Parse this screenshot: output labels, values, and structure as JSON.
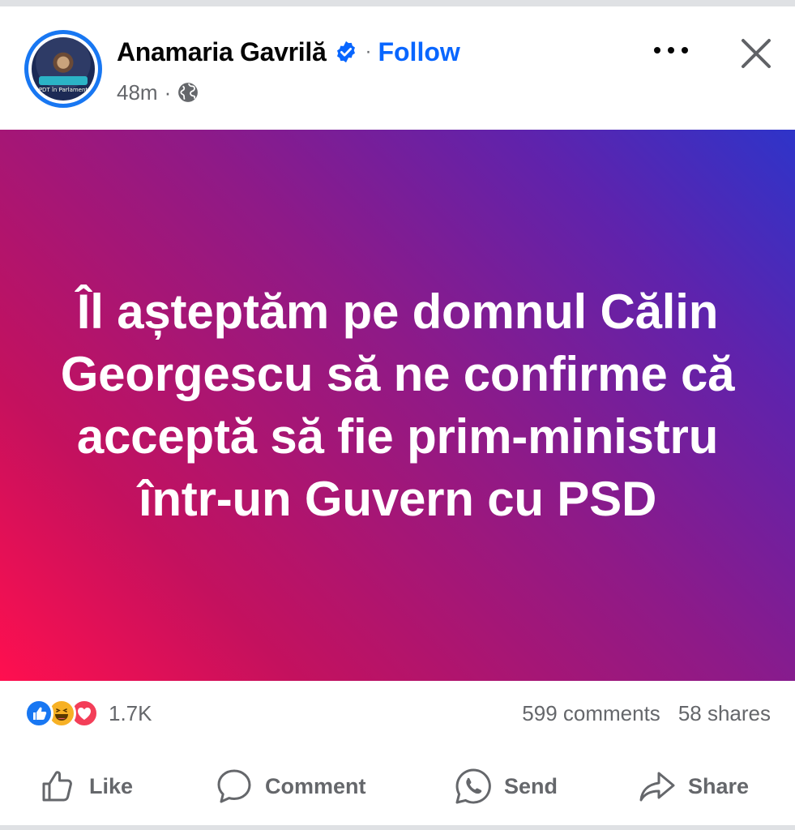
{
  "post": {
    "author": "Anamaria Gavrilă",
    "follow_label": "Follow",
    "separator": "·",
    "time": "48m",
    "meta_separator": "·",
    "avatar_text": "PDT în Parlament",
    "text": "Îl așteptăm pe domnul Călin Georgescu să ne confirme că acceptă să fie prim-ministru într-un Guvern cu PSD",
    "background_gradient": [
      "#ff0f4f",
      "#8e1a88",
      "#2e34c9"
    ],
    "text_color": "#ffffff"
  },
  "stats": {
    "reactions": [
      "like-icon",
      "haha-icon",
      "love-icon"
    ],
    "reaction_count": "1.7K",
    "comments": "599 comments",
    "shares": "58 shares"
  },
  "actions": {
    "like": "Like",
    "comment": "Comment",
    "send": "Send",
    "share": "Share"
  },
  "colors": {
    "accent": "#0866ff",
    "secondary_text": "#65676b"
  }
}
